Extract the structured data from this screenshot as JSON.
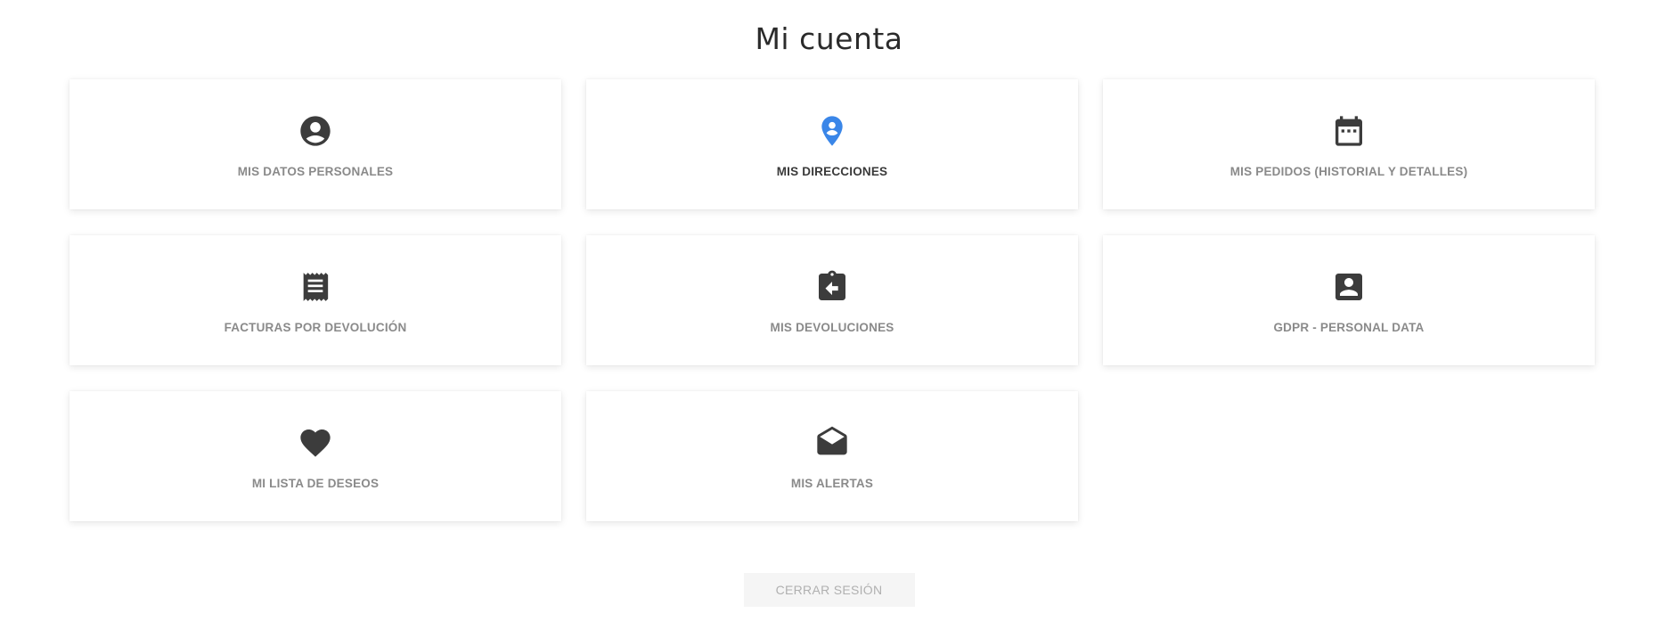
{
  "title": "Mi cuenta",
  "colors": {
    "icon": "#3c3c3c",
    "icon_active": "#3a86e8",
    "label": "#8a8a8a",
    "label_active": "#3a3a3a"
  },
  "cards": [
    {
      "label": "MIS DATOS PERSONALES",
      "icon": "account-circle-icon"
    },
    {
      "label": "MIS DIRECCIONES",
      "icon": "location-pin-icon",
      "active": true
    },
    {
      "label": "MIS PEDIDOS (HISTORIAL Y DETALLES)",
      "icon": "calendar-icon"
    },
    {
      "label": "FACTURAS POR DEVOLUCIÓN",
      "icon": "receipt-icon"
    },
    {
      "label": "MIS DEVOLUCIONES",
      "icon": "clipboard-return-icon"
    },
    {
      "label": "GDPR - PERSONAL DATA",
      "icon": "account-box-icon"
    },
    {
      "label": "MI LISTA DE DESEOS",
      "icon": "heart-icon"
    },
    {
      "label": "MIS ALERTAS",
      "icon": "open-envelope-icon"
    }
  ],
  "logout_label": "CERRAR SESIÓN"
}
